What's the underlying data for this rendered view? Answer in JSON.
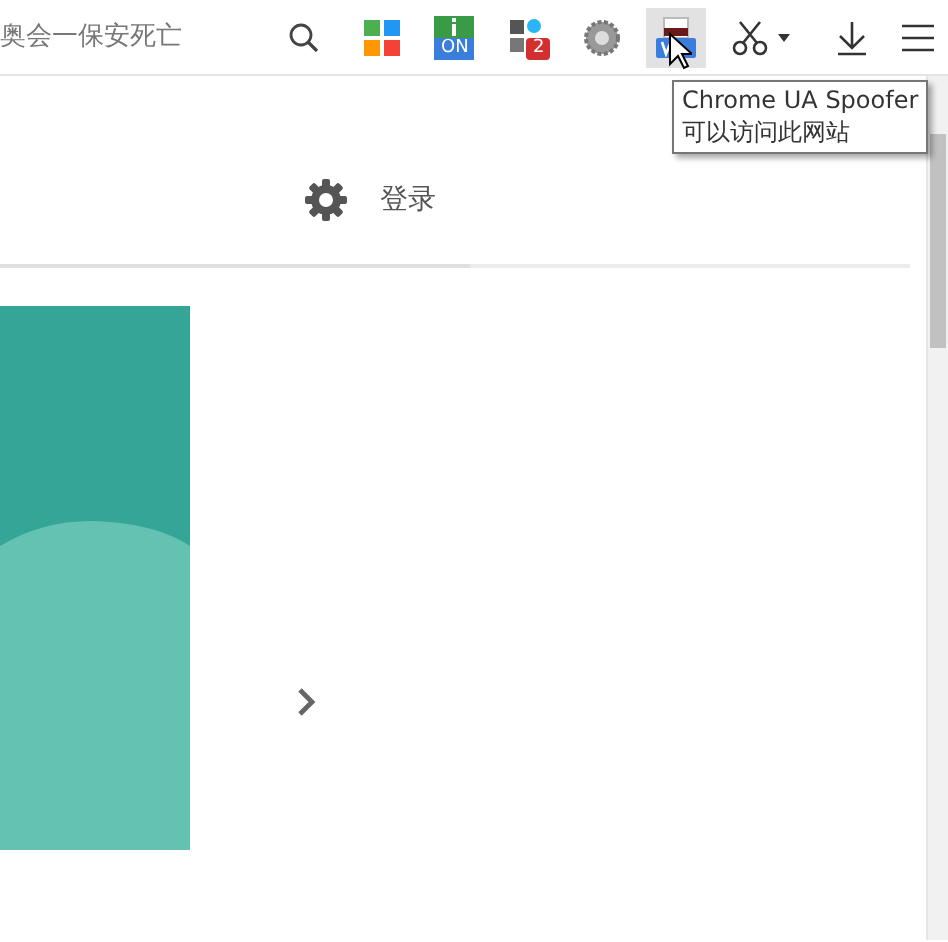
{
  "toolbar": {
    "address_text": "奥会一保安死亡",
    "extensions": [
      {
        "kind": "tiles",
        "selected": false
      },
      {
        "kind": "info",
        "label": "ON",
        "selected": false
      },
      {
        "kind": "badge",
        "badge": "2",
        "selected": false
      },
      {
        "kind": "gear",
        "selected": false
      },
      {
        "kind": "spoofer",
        "selected": true
      },
      {
        "kind": "scissors",
        "selected": false
      }
    ]
  },
  "tooltip": {
    "title": "Chrome UA Spoofer",
    "subtitle": "可以访问此网站"
  },
  "header": {
    "login": "登录"
  }
}
